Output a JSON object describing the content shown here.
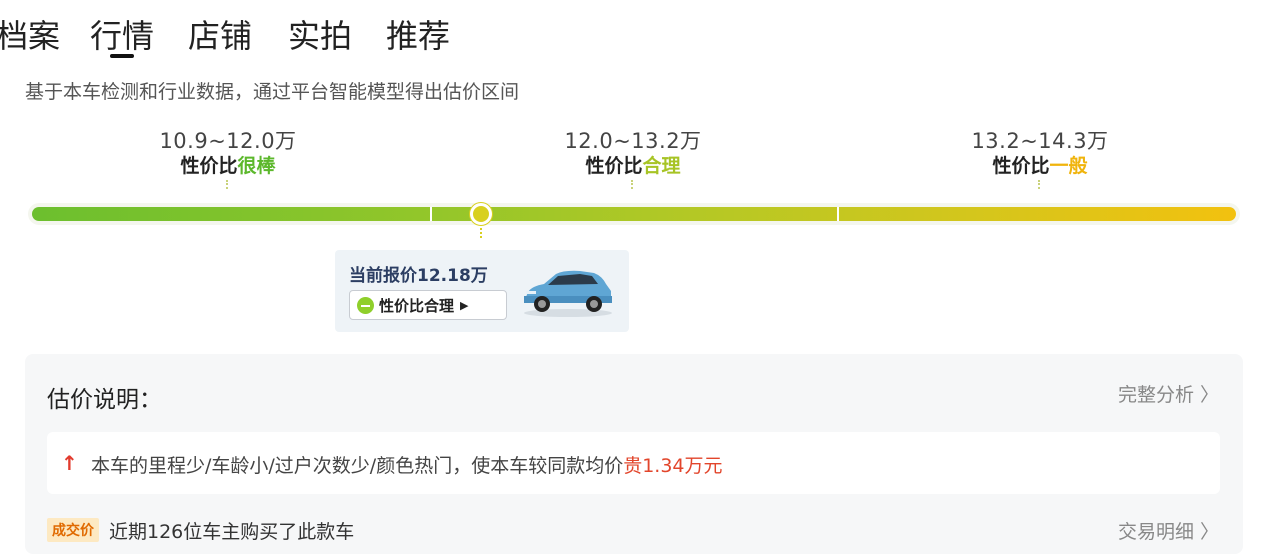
{
  "tabs": [
    {
      "label": "档案",
      "active": false
    },
    {
      "label": "行情",
      "active": true
    },
    {
      "label": "店铺",
      "active": false
    },
    {
      "label": "实拍",
      "active": false
    },
    {
      "label": "推荐",
      "active": false
    }
  ],
  "subtitle": "基于本车检测和行业数据，通过平台智能模型得出估价区间",
  "bands": [
    {
      "range": "10.9~12.0万",
      "label_prefix": "性价比",
      "label_value": "很棒",
      "color": "#5cb82c"
    },
    {
      "range": "12.0~13.2万",
      "label_prefix": "性价比",
      "label_value": "合理",
      "color": "#a7c425"
    },
    {
      "range": "13.2~14.3万",
      "label_prefix": "性价比",
      "label_value": "一般",
      "color": "#f0b40c"
    }
  ],
  "current": {
    "price_text": "当前报价12.18万",
    "price_value": 12.18,
    "badge_text": "性价比合理",
    "scale_min": 10.9,
    "scale_max": 14.3
  },
  "panel": {
    "title": "估价说明：",
    "link": "完整分析 〉",
    "reason_prefix": "本车的里程少/车龄小/过户次数少/颜色热门，使本车较同款均价",
    "reason_highlight": "贵1.34万元",
    "deal_tag": "成交价",
    "deal_text": "近期126位车主购买了此款车",
    "deal_link": "交易明细 〉"
  },
  "colors": {
    "accent_red": "#e2452b",
    "bar_start": "#6cbf2e",
    "bar_end": "#f2c10f"
  }
}
